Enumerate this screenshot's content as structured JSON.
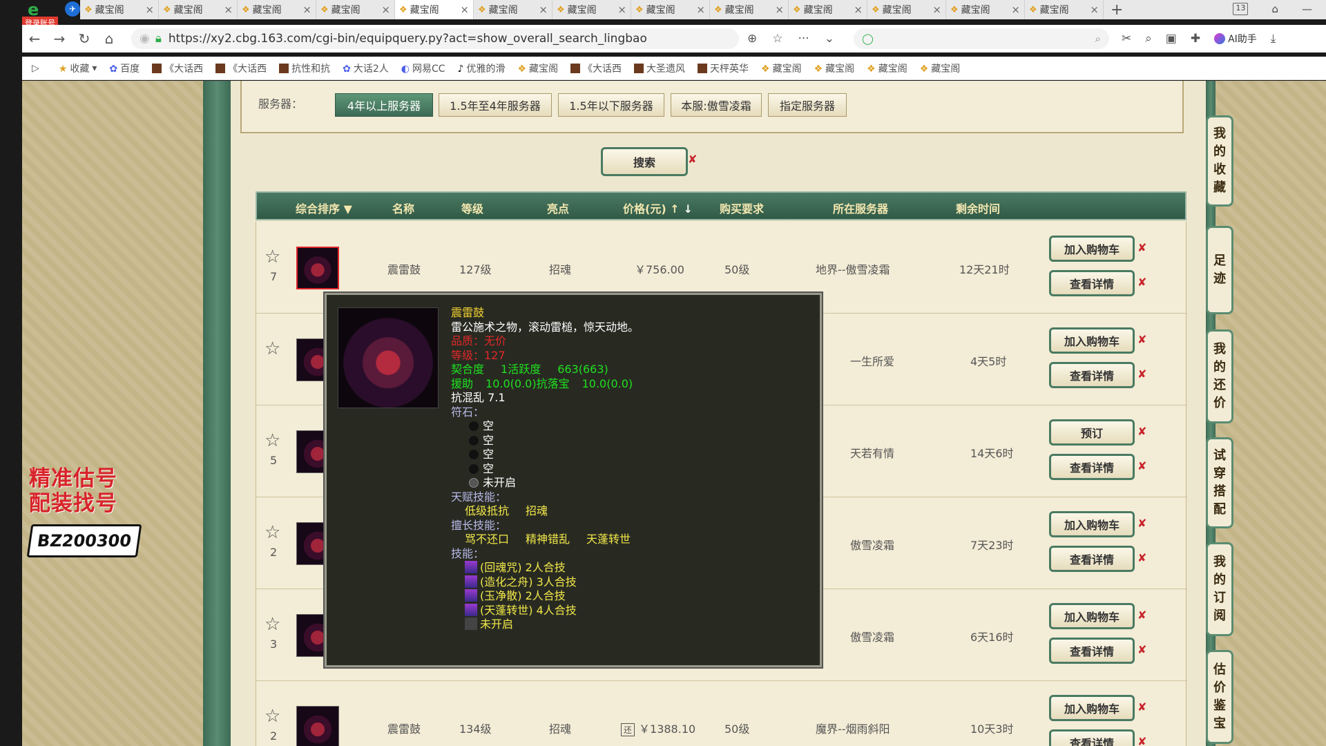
{
  "browser": {
    "login_badge": "登录账号",
    "tabs": [
      "藏宝阁",
      "藏宝阁",
      "藏宝阁",
      "藏宝阁",
      "藏宝阁",
      "藏宝阁",
      "藏宝阁",
      "藏宝阁",
      "藏宝阁",
      "藏宝阁",
      "藏宝阁",
      "藏宝阁",
      "藏宝阁"
    ],
    "active_tab_index": 4,
    "new_tab": "+",
    "tab_count": "13",
    "url": "https://xy2.cbg.163.com/cgi-bin/equipquery.py?act=show_overall_search_lingbao",
    "ai_helper": "AI助手",
    "bookmarks": [
      "收藏",
      "百度",
      "《大话西",
      "《大话西",
      "抗性和抗",
      "大话2人",
      "网易CC",
      "优雅的滑",
      "藏宝阁",
      "《大话西",
      "大圣遗风",
      "天枰英华",
      "藏宝阁",
      "藏宝阁",
      "藏宝阁",
      "藏宝阁"
    ]
  },
  "ad": {
    "line1": "精准估号",
    "line2": "配装找号",
    "code": "BZ200300"
  },
  "side_nav": [
    {
      "label": "我的收藏"
    },
    {
      "label": "足迹"
    },
    {
      "label": "我的还价"
    },
    {
      "label": "试穿搭配"
    },
    {
      "label": "我的订阅"
    },
    {
      "label": "估价鉴宝"
    }
  ],
  "filter": {
    "label": "服务器：",
    "options": [
      "4年以上服务器",
      "1.5年至4年服务器",
      "1.5年以下服务器",
      "本服:傲雪凌霜",
      "指定服务器"
    ],
    "active_index": 0
  },
  "search_button": "搜索",
  "table": {
    "headers": {
      "sort": "综合排序",
      "name": "名称",
      "level": "等级",
      "highlight": "亮点",
      "price": "价格(元)",
      "requirement": "购买要求",
      "server": "所在服务器",
      "time_left": "剩余时间"
    },
    "rows": [
      {
        "fav": "7",
        "name": "震雷鼓",
        "level": "127级",
        "highlight": "招魂",
        "price": "￥756.00",
        "requirement": "50级",
        "server": "地界--傲雪凌霜",
        "time_left": "12天21时",
        "btn1": "加入购物车",
        "btn2": "查看详情"
      },
      {
        "fav": "",
        "name": "",
        "level": "",
        "highlight": "",
        "price": "",
        "requirement": "",
        "server": "一生所爱",
        "time_left": "4天5时",
        "btn1": "加入购物车",
        "btn2": "查看详情"
      },
      {
        "fav": "5",
        "name": "",
        "level": "",
        "highlight": "",
        "price": "",
        "requirement": "",
        "server": "天若有情",
        "time_left": "14天6时",
        "btn1": "预订",
        "btn2": "查看详情"
      },
      {
        "fav": "2",
        "name": "",
        "level": "",
        "highlight": "",
        "price": "",
        "requirement": "",
        "server": "傲雪凌霜",
        "time_left": "7天23时",
        "btn1": "加入购物车",
        "btn2": "查看详情"
      },
      {
        "fav": "3",
        "name": "",
        "level": "",
        "highlight": "",
        "price": "",
        "requirement": "",
        "server": "傲雪凌霜",
        "time_left": "6天16时",
        "btn1": "加入购物车",
        "btn2": "查看详情"
      },
      {
        "fav": "2",
        "name": "震雷鼓",
        "level": "134级",
        "highlight": "招魂",
        "price": "￥1388.10",
        "bargain": "还",
        "requirement": "50级",
        "server": "魔界--烟雨斜阳",
        "time_left": "10天3时",
        "btn1": "加入购物车",
        "btn2": "查看详情"
      }
    ]
  },
  "tooltip": {
    "name": "震雷鼓",
    "desc": "雷公施术之物，滚动雷槌，惊天动地。",
    "quality": "品质：无价",
    "level": "等级：127",
    "affinity_label": "契合度",
    "activity_label": "1活跃度",
    "activity_value": "663(663)",
    "assist": "援助",
    "assist_value": "10.0(0.0)抗落宝",
    "drop_value": "10.0(0.0)",
    "resist": "抗混乱 7.1",
    "runes_label": "符石：",
    "runes": [
      "空",
      "空",
      "空",
      "空",
      "未开启"
    ],
    "talent_label": "天赋技能：",
    "talents": [
      "低级抵抗",
      "招魂"
    ],
    "special_label": "擅长技能：",
    "specials": [
      "骂不还口",
      "精神错乱",
      "天蓬转世"
    ],
    "skills_label": "技能：",
    "skills": [
      "(回魂咒) 2人合技",
      "(造化之舟) 3人合技",
      "(玉净散) 2人合技",
      "(天蓬转世) 4人合技",
      "未开启"
    ]
  }
}
